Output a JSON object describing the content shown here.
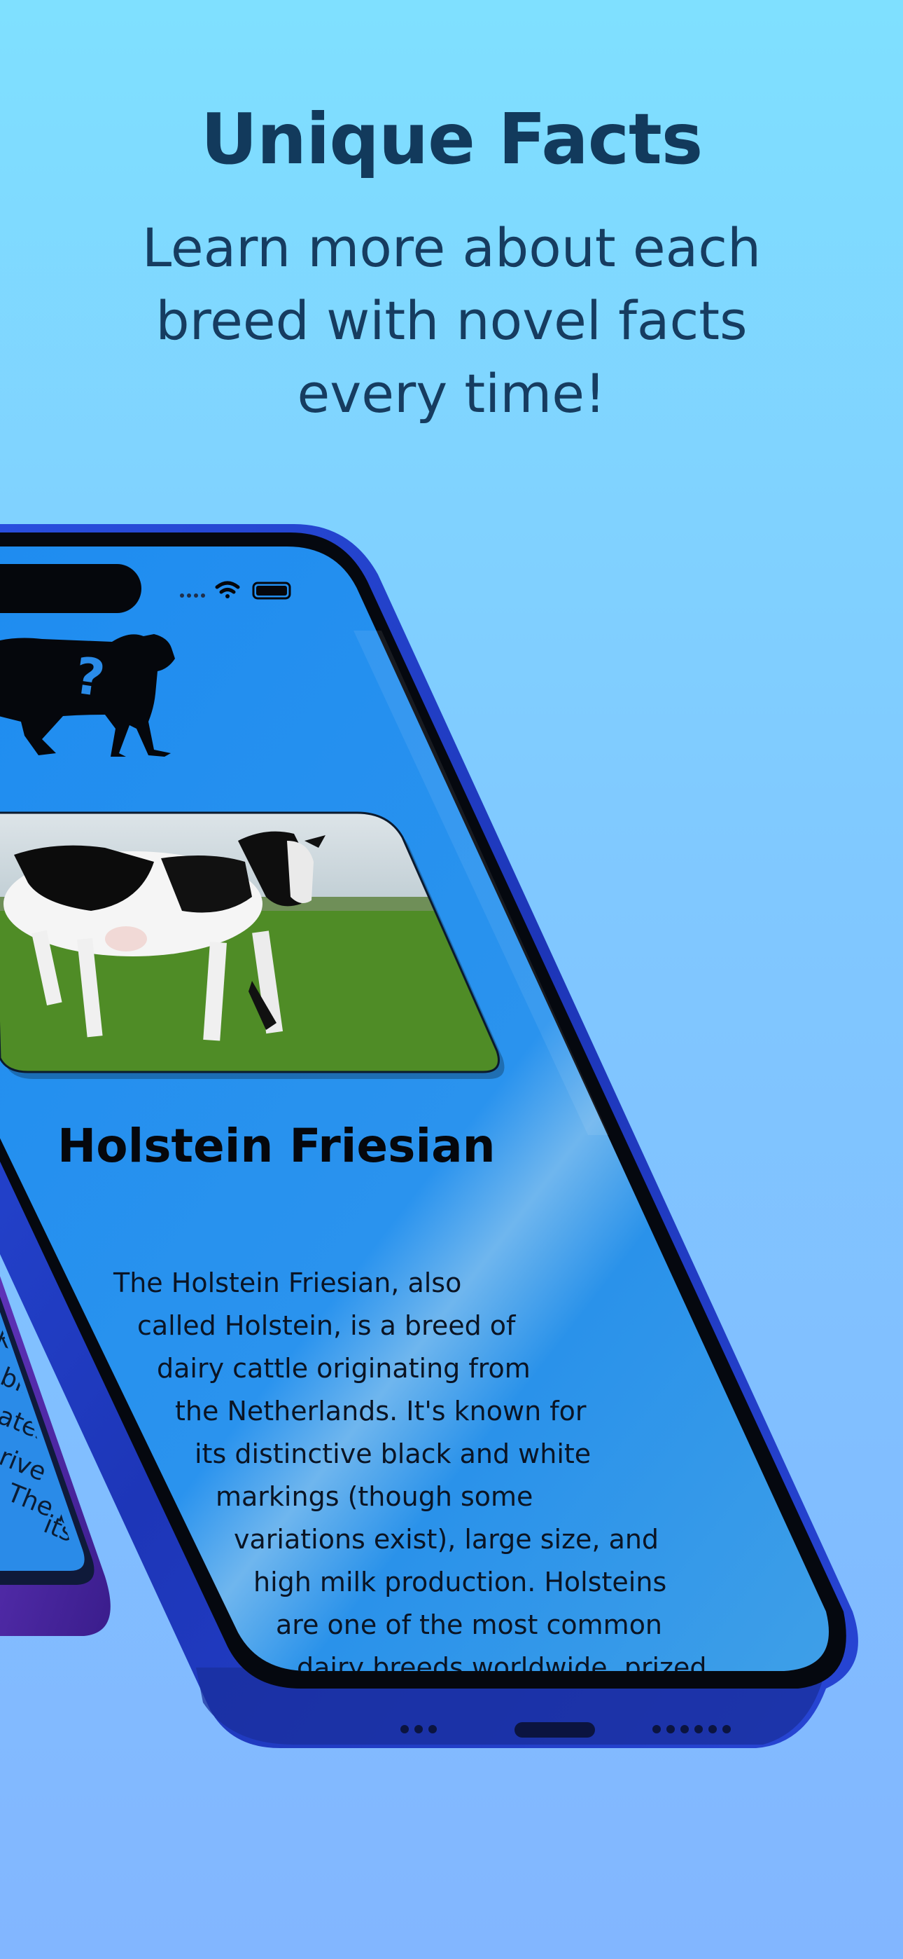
{
  "marketing": {
    "headline": "Unique Facts",
    "subline": "Learn more about each breed with novel facts every time!"
  },
  "app": {
    "breed_name": "Holstein Friesian",
    "description_lines": [
      "The Holstein Friesian, also",
      "called Holstein, is a breed of",
      "dairy cattle originating from",
      "the Netherlands.  It's known for",
      "its distinctive black and white",
      "markings (though some",
      "variations exist), large size, and",
      "high milk production.  Holsteins",
      "are one of the most common",
      "dairy breeds worldwide, prized"
    ],
    "back_phone_lines": [
      "ke",
      "bili",
      "ates",
      "rive c",
      "The b",
      "its n",
      "w"
    ]
  },
  "colors": {
    "background_top": "#7fe0ff",
    "background_bottom": "#82b6ff",
    "screen_blue": "#1f8ff0",
    "frame_blue": "#1e3fc0",
    "headline": "#123a5c"
  },
  "icons": {
    "logo": "cow-question-icon",
    "wifi": "wifi-icon",
    "battery": "battery-icon"
  }
}
